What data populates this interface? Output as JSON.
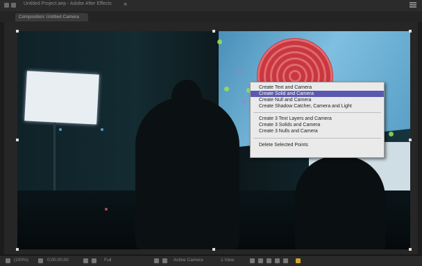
{
  "window": {
    "title": "Untitled Project.aep - Adobe After Effects",
    "tab_label": "Composition: Untitled Camera"
  },
  "context_menu": {
    "items": [
      {
        "label": "Create Text and Camera"
      },
      {
        "label": "Create Solid and Camera",
        "selected": true
      },
      {
        "label": "Create Null and Camera"
      },
      {
        "label": "Create Shadow Catcher, Camera and Light"
      },
      {
        "label": "Create 3 Text Layers and Camera"
      },
      {
        "label": "Create 3 Solids and Camera"
      },
      {
        "label": "Create 3 Nulls and Camera"
      },
      {
        "label": "Delete Selected Points"
      }
    ]
  },
  "bottom_bar": {
    "zoom": "(100%)",
    "time": "0;00;00;00",
    "resolution": "Full",
    "camera": "Active Camera",
    "views": "1 View"
  },
  "colors": {
    "menu_highlight": "#5b58b0",
    "track_point": "#9adf5a",
    "target_red": "#c9373f"
  }
}
